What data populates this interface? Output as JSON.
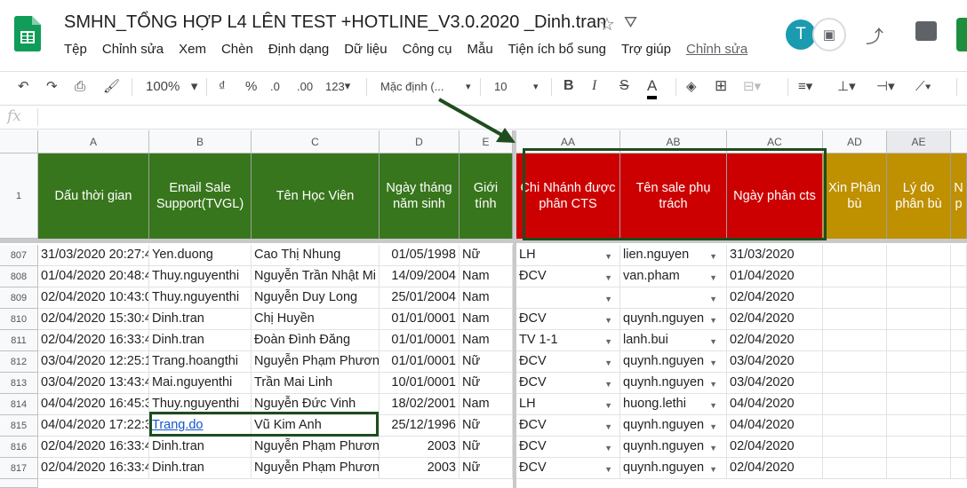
{
  "doc": {
    "title": "SMHN_TỔNG HỢP L4 LÊN TEST +HOTLINE_V3.0.2020 _Dinh.tran",
    "avatar_letter": "T"
  },
  "menu": [
    "Tệp",
    "Chỉnh sửa",
    "Xem",
    "Chèn",
    "Định dạng",
    "Dữ liệu",
    "Công cụ",
    "Mẫu",
    "Tiện ích bổ sung",
    "Trợ giúp",
    "Chỉnh sửa"
  ],
  "toolbar": {
    "zoom": "100%",
    "currency": "₫",
    "percent": "%",
    "dec_less": ".0",
    "dec_more": ".00",
    "format": "123",
    "font": "Mặc định (...",
    "font_size": "10",
    "bold": "B",
    "italic": "I",
    "strike": "S",
    "text_color": "A"
  },
  "formula": {
    "fx": "fx",
    "value": ""
  },
  "columns": [
    "A",
    "B",
    "C",
    "D",
    "E",
    "AA",
    "AB",
    "AC",
    "AD",
    "AE"
  ],
  "header_row": {
    "row_num": "1",
    "cells": [
      "Dấu thời gian",
      "Email Sale Support(TVGL)",
      "Tên Học Viên",
      "Ngày tháng năm sinh",
      "Giới tính",
      "Chi Nhánh được phân CTS",
      "Tên sale  phụ trách",
      "Ngày phân cts",
      "Xin Phân bù",
      "Lý do phân bù",
      "N p"
    ]
  },
  "rows": [
    {
      "n": "807",
      "a": "31/03/2020 20:27:4",
      "b": "Yen.duong",
      "c": "Cao Thị Nhung",
      "d": "01/05/1998",
      "e": "Nữ",
      "aa": "LH",
      "ab": "lien.nguyen",
      "ac": "31/03/2020"
    },
    {
      "n": "808",
      "a": "01/04/2020 20:48:4",
      "b": "Thuy.nguyenthi",
      "c": "Nguyễn Trần Nhật Mi",
      "d": "14/09/2004",
      "e": "Nam",
      "aa": "ĐCV",
      "ab": "van.pham",
      "ac": "01/04/2020"
    },
    {
      "n": "809",
      "a": "02/04/2020 10:43:0",
      "b": "Thuy.nguyenthi",
      "c": "Nguyễn Duy Long",
      "d": "25/01/2004",
      "e": "Nam",
      "aa": "",
      "ab": "",
      "ac": "02/04/2020"
    },
    {
      "n": "810",
      "a": "02/04/2020 15:30:4",
      "b": "Dinh.tran",
      "c": "Chị Huyền",
      "d": "01/01/0001",
      "e": "Nam",
      "aa": "ĐCV",
      "ab": "quynh.nguyen",
      "ac": "02/04/2020"
    },
    {
      "n": "811",
      "a": "02/04/2020 16:33:4",
      "b": "Dinh.tran",
      "c": "Đoàn Đình Đăng",
      "d": "01/01/0001",
      "e": "Nam",
      "aa": "TV 1-1",
      "ab": "lanh.bui",
      "ac": "02/04/2020"
    },
    {
      "n": "812",
      "a": "03/04/2020 12:25:1",
      "b": "Trang.hoangthi",
      "c": "Nguyễn Phạm Phươn",
      "d": "01/01/0001",
      "e": "Nữ",
      "aa": "ĐCV",
      "ab": "quynh.nguyen",
      "ac": "03/04/2020"
    },
    {
      "n": "813",
      "a": "03/04/2020 13:43:4",
      "b": "Mai.nguyenthi",
      "c": "Trần Mai Linh",
      "d": "10/01/0001",
      "e": "Nữ",
      "aa": "ĐCV",
      "ab": "quynh.nguyen",
      "ac": "03/04/2020"
    },
    {
      "n": "814",
      "a": "04/04/2020 16:45:3",
      "b": "Thuy.nguyenthi",
      "c": "Nguyễn Đức Vinh",
      "d": "18/02/2001",
      "e": "Nam",
      "aa": "LH",
      "ab": "huong.lethi",
      "ac": "04/04/2020"
    },
    {
      "n": "815",
      "a": "04/04/2020 17:22:3",
      "b": "Trang.do",
      "c": "Vũ Kim Anh",
      "d": "25/12/1996",
      "e": "Nữ",
      "aa": "ĐCV",
      "ab": "quynh.nguyen",
      "ac": "04/04/2020"
    },
    {
      "n": "816",
      "a": "02/04/2020 16:33:4",
      "b": "Dinh.tran",
      "c": "Nguyễn Phạm Phươn",
      "d": "2003",
      "e": "Nữ",
      "aa": "ĐCV",
      "ab": "quynh.nguyen",
      "ac": "02/04/2020"
    },
    {
      "n": "817",
      "a": "02/04/2020 16:33:4",
      "b": "Dinh.tran",
      "c": "Nguyễn Phạm Phươn",
      "d": "2003",
      "e": "Nữ",
      "aa": "ĐCV",
      "ab": "quynh.nguyen",
      "ac": "02/04/2020"
    }
  ],
  "colors": {
    "green_header": "#38761d",
    "red_header": "#cc0000",
    "gold_header": "#bf9000",
    "annotation": "#1e4d1e"
  }
}
